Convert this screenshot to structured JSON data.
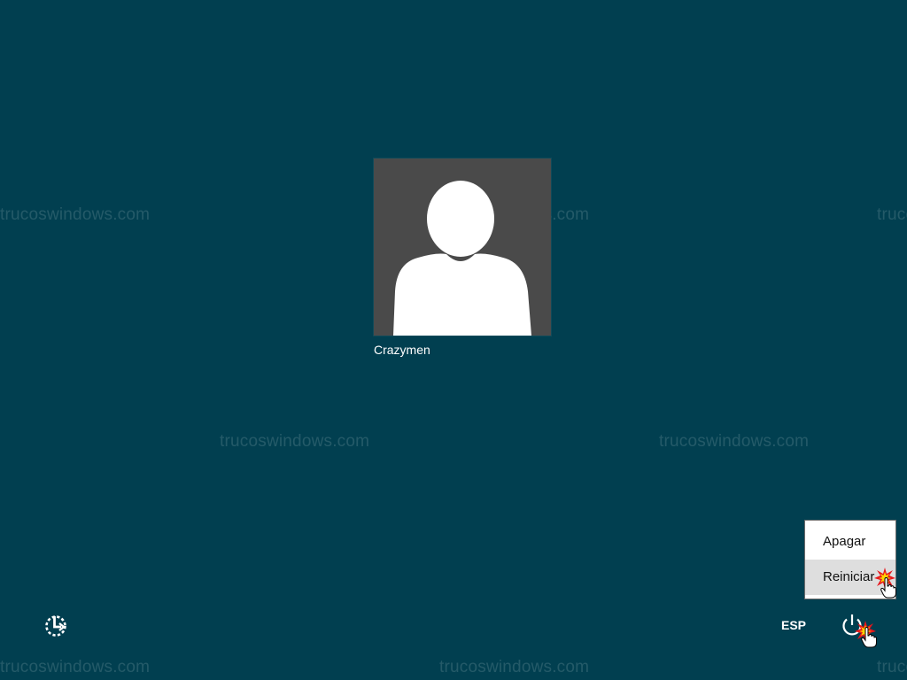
{
  "watermark_text": "trucoswindows.com",
  "user": {
    "name": "Crazymen",
    "avatar_icon": "user-silhouette-icon"
  },
  "bottom_bar": {
    "ease_of_access_icon": "ease-of-access-icon",
    "language": "ESP",
    "power_icon": "power-icon"
  },
  "power_menu": {
    "items": [
      {
        "label": "Apagar"
      },
      {
        "label": "Reiniciar"
      }
    ],
    "hovered_item": "Reiniciar"
  },
  "colors": {
    "background": "#013f50",
    "avatar_background": "#4a4a4a",
    "menu_background": "#ffffff",
    "menu_hover": "#dedede"
  }
}
